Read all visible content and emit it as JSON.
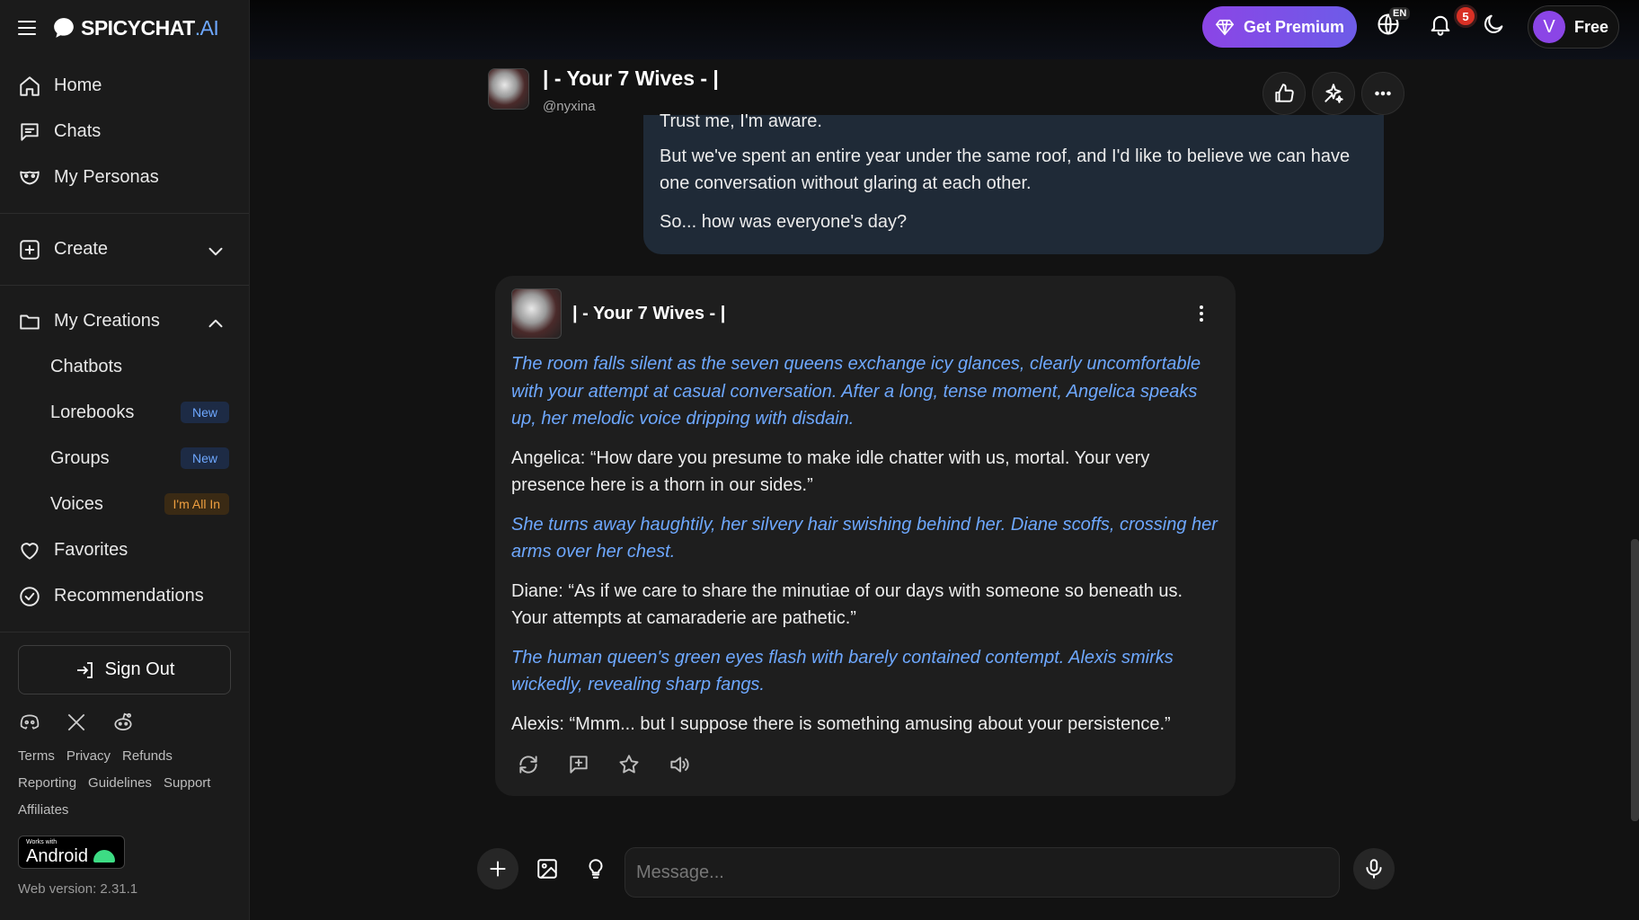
{
  "brand": {
    "name": "SPICYCHAT",
    "suffix": ".AI"
  },
  "sidebar": {
    "nav": [
      {
        "label": "Home",
        "icon": "home-icon"
      },
      {
        "label": "Chats",
        "icon": "chat-icon"
      },
      {
        "label": "My Personas",
        "icon": "mask-icon"
      }
    ],
    "create": {
      "label": "Create"
    },
    "my_creations": {
      "label": "My Creations",
      "items": [
        {
          "label": "Chatbots",
          "badge": ""
        },
        {
          "label": "Lorebooks",
          "badge": "New"
        },
        {
          "label": "Groups",
          "badge": "New"
        },
        {
          "label": "Voices",
          "badge": "I'm All In"
        }
      ]
    },
    "favorites": {
      "label": "Favorites"
    },
    "recommendations": {
      "label": "Recommendations"
    },
    "sign_out": "Sign Out",
    "links": [
      "Terms",
      "Privacy",
      "Refunds",
      "Reporting",
      "Guidelines",
      "Support",
      "Affiliates"
    ],
    "android": {
      "works_with": "Works with",
      "label": "Android"
    },
    "version": "Web version: 2.31.1"
  },
  "topbar": {
    "premium_label": "Get Premium",
    "language": "EN",
    "notifications": "5",
    "user_initial": "V",
    "plan": "Free"
  },
  "chat": {
    "bot_name": "| - Your 7 Wives - |",
    "handle": "@nyxina",
    "user_message": [
      "Trust me, I'm aware.",
      "But we've spent an entire year under the same roof, and I'd like to believe we can have one conversation without glaring at each other.",
      "So... how was everyone's day?"
    ],
    "bot_message": [
      {
        "type": "action",
        "text": "The room falls silent as the seven queens exchange icy glances, clearly uncomfortable with your attempt at casual conversation. After a long, tense moment, Angelica speaks up, her melodic voice dripping with disdain."
      },
      {
        "type": "speech",
        "text": "Angelica: “How dare you presume to make idle chatter with us, mortal. Your very presence here is a thorn in our sides.”"
      },
      {
        "type": "action",
        "text": "She turns away haughtily, her silvery hair swishing behind her. Diane scoffs, crossing her arms over her chest."
      },
      {
        "type": "speech",
        "text": "Diane: “As if we care to share the minutiae of our days with someone so beneath us. Your attempts at camaraderie are pathetic.”"
      },
      {
        "type": "action",
        "text": "The human queen's green eyes flash with barely contained contempt. Alexis smirks wickedly, revealing sharp fangs."
      },
      {
        "type": "speech",
        "text": "Alexis: “Mmm... but I suppose there is something amusing about your persistence.”"
      }
    ]
  },
  "composer": {
    "placeholder": "Message..."
  },
  "colors": {
    "accent": "#6ea8ff",
    "premium": "#8b45e6",
    "badge_red": "#d93025"
  }
}
